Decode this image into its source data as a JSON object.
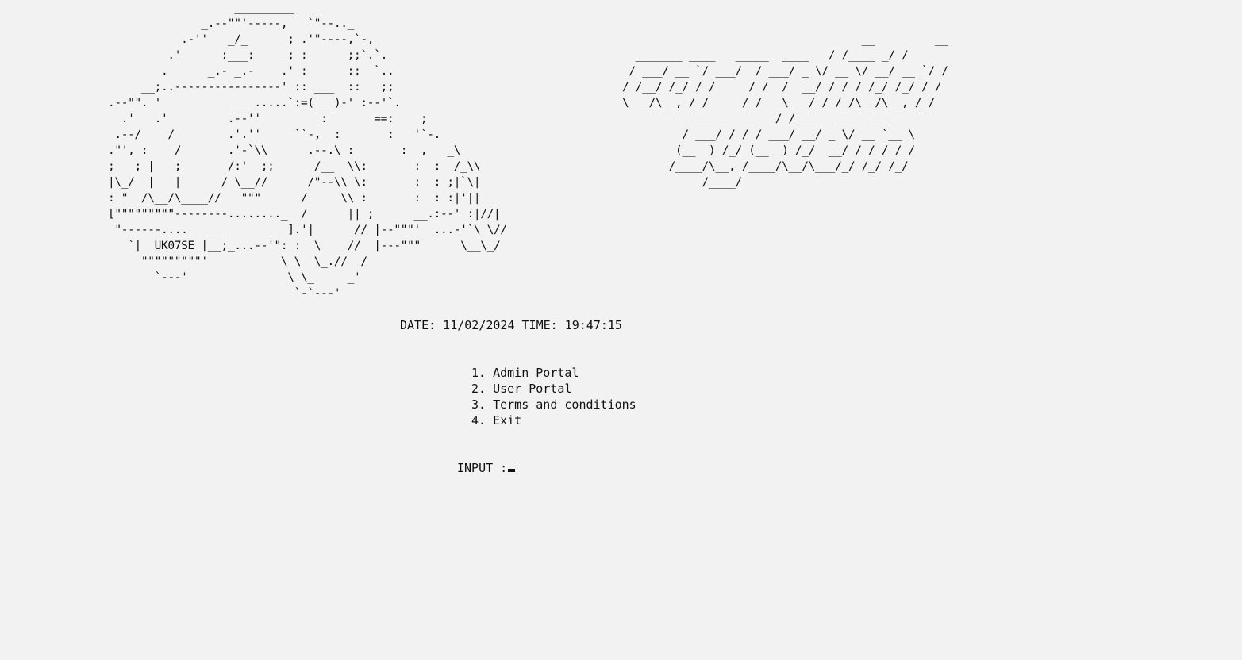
{
  "car_art": "                   _________\n              _.--\"\"'-----,   `\"--.._\n           .-''   _/_      ; .'\"----,`-,\n         .'      :___:     ; :      ;;`.`.\n        .      _.- _.-    .' :      ::  `..\n     __;..----------------' :: ___  ::   ;;\n.--\"\". '           ___.....`:=(___)-' :--'`.\n  .'   .'         .--''__       :       ==:    ;\n .--/    /        .'.''     ``-,  :       :   '`-.\n.\"', :    /       .'-`\\\\      .--.\\ :       :  ,   _\\\n;   ; |   ;       /:'  ;;      /__  \\\\:       :  :  /_\\\\\n|\\_/  |   |      / \\__//      /\"--\\\\ \\:       :  : ;|`\\|\n: \"  /\\__/\\____//   \"\"\"      /     \\\\ :       :  : :|'||\n[\"\"\"\"\"\"\"\"\"--------........_  /      || ;      __.:--' :|//|\n \"------....______         ].'|      // |--\"\"\"'__...-'`\\ \\//\n   `|  UK07SE |__;_...--'\": :  \\    //  |---\"\"\"      \\__\\_/\n     \"\"\"\"\"\"\"\"\"'           \\ \\  \\_.//  /\n       `---'               \\ \\_     _'\n                            `-`---'",
  "title_art": "                                    __         __\n  _______ ____   _____  ____   / /____ _/ /\n / ___/ __ `/ ___/  / ___/ _ \\/ __ \\/ __/ __ `/ /\n/ /__/ /_/ / /     / /  /  __/ / / / /_/ /_/ / /\n\\___/\\__,_/_/     /_/   \\___/_/ /_/\\__/\\__,_/_/\n          ______  _____/ /____  ____ ___\n         / ___/ / / / ___/ __/ _ \\/ __ `__ \\\n        (__  ) /_/ (__  ) /_/  __/ / / / / /\n       /____/\\__, /____/\\__/\\___/_/ /_/ /_/\n            /____/",
  "datetime": "DATE: 11/02/2024 TIME: 19:47:15",
  "menu": [
    "1. Admin Portal",
    "2. User Portal",
    "3. Terms and conditions",
    "4. Exit"
  ],
  "prompt": "INPUT :"
}
